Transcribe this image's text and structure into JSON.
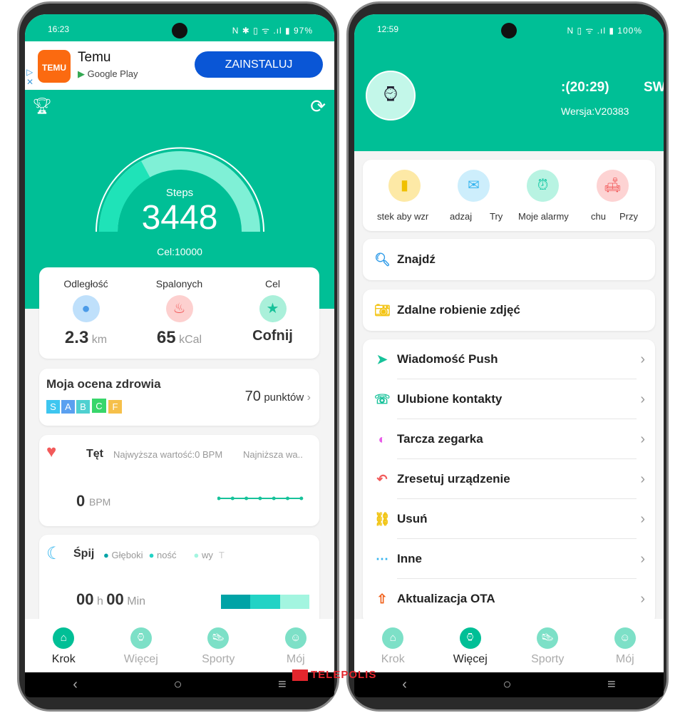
{
  "left": {
    "status": {
      "time": "16:23",
      "icons": "N ✱ ▯ ᯤ .ıl ▮",
      "battery": "97%"
    },
    "ad": {
      "app_logo": "TEMU",
      "app_name": "Temu",
      "store": "Google Play",
      "install": "ZAINSTALUJ"
    },
    "steps": {
      "label": "Steps",
      "value": "3448",
      "goal": "Cel:10000",
      "progress": 0.34
    },
    "stats": [
      {
        "label": "Odległość",
        "value": "2.3",
        "unit": "km"
      },
      {
        "label": "Spalonych",
        "value": "65",
        "unit": "kCal"
      },
      {
        "label": "Cel",
        "value": "Cofnij",
        "unit": ""
      }
    ],
    "health": {
      "title": "Moja ocena zdrowia",
      "grades": [
        "S",
        "A",
        "B",
        "C",
        "F"
      ],
      "selected": "C",
      "score": "70",
      "score_unit": "punktów"
    },
    "heart": {
      "title": "Tęt",
      "max": "Najwyższa wartość:0  BPM",
      "min": "Najniższa wa..",
      "value": "0",
      "unit": "BPM"
    },
    "sleep": {
      "title": "Śpij",
      "legend": [
        "Głęboki",
        "ność",
        "wy",
        "T"
      ],
      "h": "00",
      "h_unit": "h",
      "m": "00",
      "m_unit": "Min"
    },
    "nav": [
      "Krok",
      "Więcej",
      "Sporty",
      "Mój"
    ]
  },
  "right": {
    "status": {
      "time": "12:59",
      "icons": "N ▯ ᯤ .ıl ▮",
      "battery": "100%"
    },
    "device": {
      "time": ":(20:29)",
      "name": "SW",
      "version": "Wersja:V20383"
    },
    "quick": [
      "stek aby wzr",
      "adzaj",
      "Try",
      "Moje alarmy",
      "chu",
      "Przy"
    ],
    "menu": [
      "Znajdź",
      "Zdalne robienie zdjęć",
      "Wiadomość Push",
      "Ulubione kontakty",
      "Tarcza zegarka",
      "Zresetuj urządzenie",
      "Usuń",
      "Inne",
      "Aktualizacja OTA"
    ],
    "nav": [
      "Krok",
      "Więcej",
      "Sporty",
      "Mój"
    ]
  },
  "watermark": "TELEPOLIS",
  "colors": {
    "accent": "#00bf96",
    "install": "#0a56d6"
  }
}
